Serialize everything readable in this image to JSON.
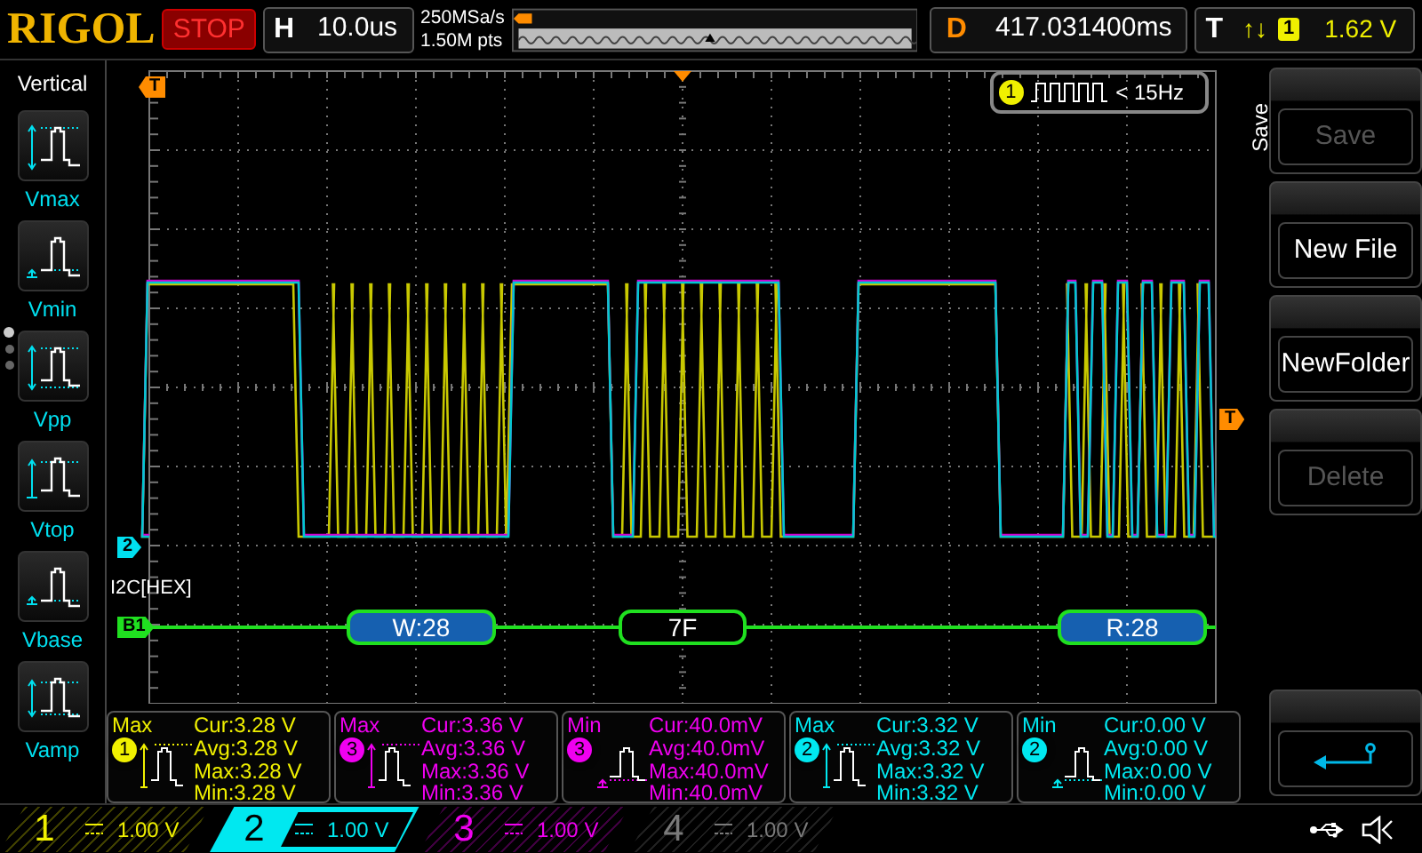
{
  "top_bar": {
    "brand": "RIGOL",
    "run_state": "STOP",
    "timebase": {
      "label": "H",
      "value": "10.0us"
    },
    "sample_rate": "250MSa/s",
    "memory_depth": "1.50M pts",
    "delay": {
      "label": "D",
      "value": "417.031400ms"
    },
    "trigger": {
      "label": "T",
      "edge": "↑↓",
      "source": "1",
      "level": "1.62 V"
    }
  },
  "sidebar": {
    "title": "Vertical",
    "items": [
      {
        "label": "Vmax",
        "kind": "vmax"
      },
      {
        "label": "Vmin",
        "kind": "vmin"
      },
      {
        "label": "Vpp",
        "kind": "vpp"
      },
      {
        "label": "Vtop",
        "kind": "vtop"
      },
      {
        "label": "Vbase",
        "kind": "vbase"
      },
      {
        "label": "Vamp",
        "kind": "vamp"
      }
    ],
    "pages": [
      {
        "selected": true
      },
      {
        "selected": false
      },
      {
        "selected": false
      }
    ]
  },
  "scope": {
    "markers": [
      {
        "label": "T",
        "kind": "trigger-position"
      },
      {
        "label": "T",
        "kind": "trigger-level"
      },
      {
        "label": "2",
        "kind": "channel"
      },
      {
        "label": "B1",
        "kind": "bus"
      }
    ],
    "freq_counter": {
      "source": "1",
      "value": "< 15Hz"
    },
    "bus": {
      "label": "I2C[HEX]",
      "packets": [
        {
          "text": "W:28",
          "kind": "address"
        },
        {
          "text": "7F",
          "kind": "data"
        },
        {
          "text": "R:28",
          "kind": "address"
        }
      ]
    }
  },
  "measurements": [
    {
      "name": "Max",
      "channel": "1",
      "kind": "max",
      "color": "#f0f000",
      "readings": [
        "Cur:3.28 V",
        "Avg:3.28 V",
        "Max:3.28 V",
        "Min:3.28 V"
      ]
    },
    {
      "name": "Max",
      "channel": "3",
      "kind": "max",
      "color": "#f000f0",
      "readings": [
        "Cur:3.36 V",
        "Avg:3.36 V",
        "Max:3.36 V",
        "Min:3.36 V"
      ]
    },
    {
      "name": "Min",
      "channel": "3",
      "kind": "min",
      "color": "#f000f0",
      "readings": [
        "Cur:40.0mV",
        "Avg:40.0mV",
        "Max:40.0mV",
        "Min:40.0mV"
      ]
    },
    {
      "name": "Max",
      "channel": "2",
      "kind": "max",
      "color": "#00e8f0",
      "readings": [
        "Cur:3.32 V",
        "Avg:3.32 V",
        "Max:3.32 V",
        "Min:3.32 V"
      ]
    },
    {
      "name": "Min",
      "channel": "2",
      "kind": "min",
      "color": "#00e8f0",
      "readings": [
        "Cur:0.00 V",
        "Avg:0.00 V",
        "Max:0.00 V",
        "Min:0.00 V"
      ]
    }
  ],
  "menu": {
    "title": "Save",
    "items": [
      {
        "label": "Save",
        "disabled": true
      },
      {
        "label": "New File",
        "disabled": false
      },
      {
        "label": "NewFolder",
        "disabled": false
      },
      {
        "label": "Delete",
        "disabled": true
      }
    ]
  },
  "channels": [
    {
      "label": "1",
      "scale": "1.00 V",
      "color": "#f0f000",
      "selected": false
    },
    {
      "label": "2",
      "scale": "1.00 V",
      "color": "#00e8f0",
      "selected": true
    },
    {
      "label": "3",
      "scale": "1.00 V",
      "color": "#f000f0",
      "selected": false
    },
    {
      "label": "4",
      "scale": "1.00 V",
      "color": "#7a7a7a",
      "selected": false
    }
  ]
}
